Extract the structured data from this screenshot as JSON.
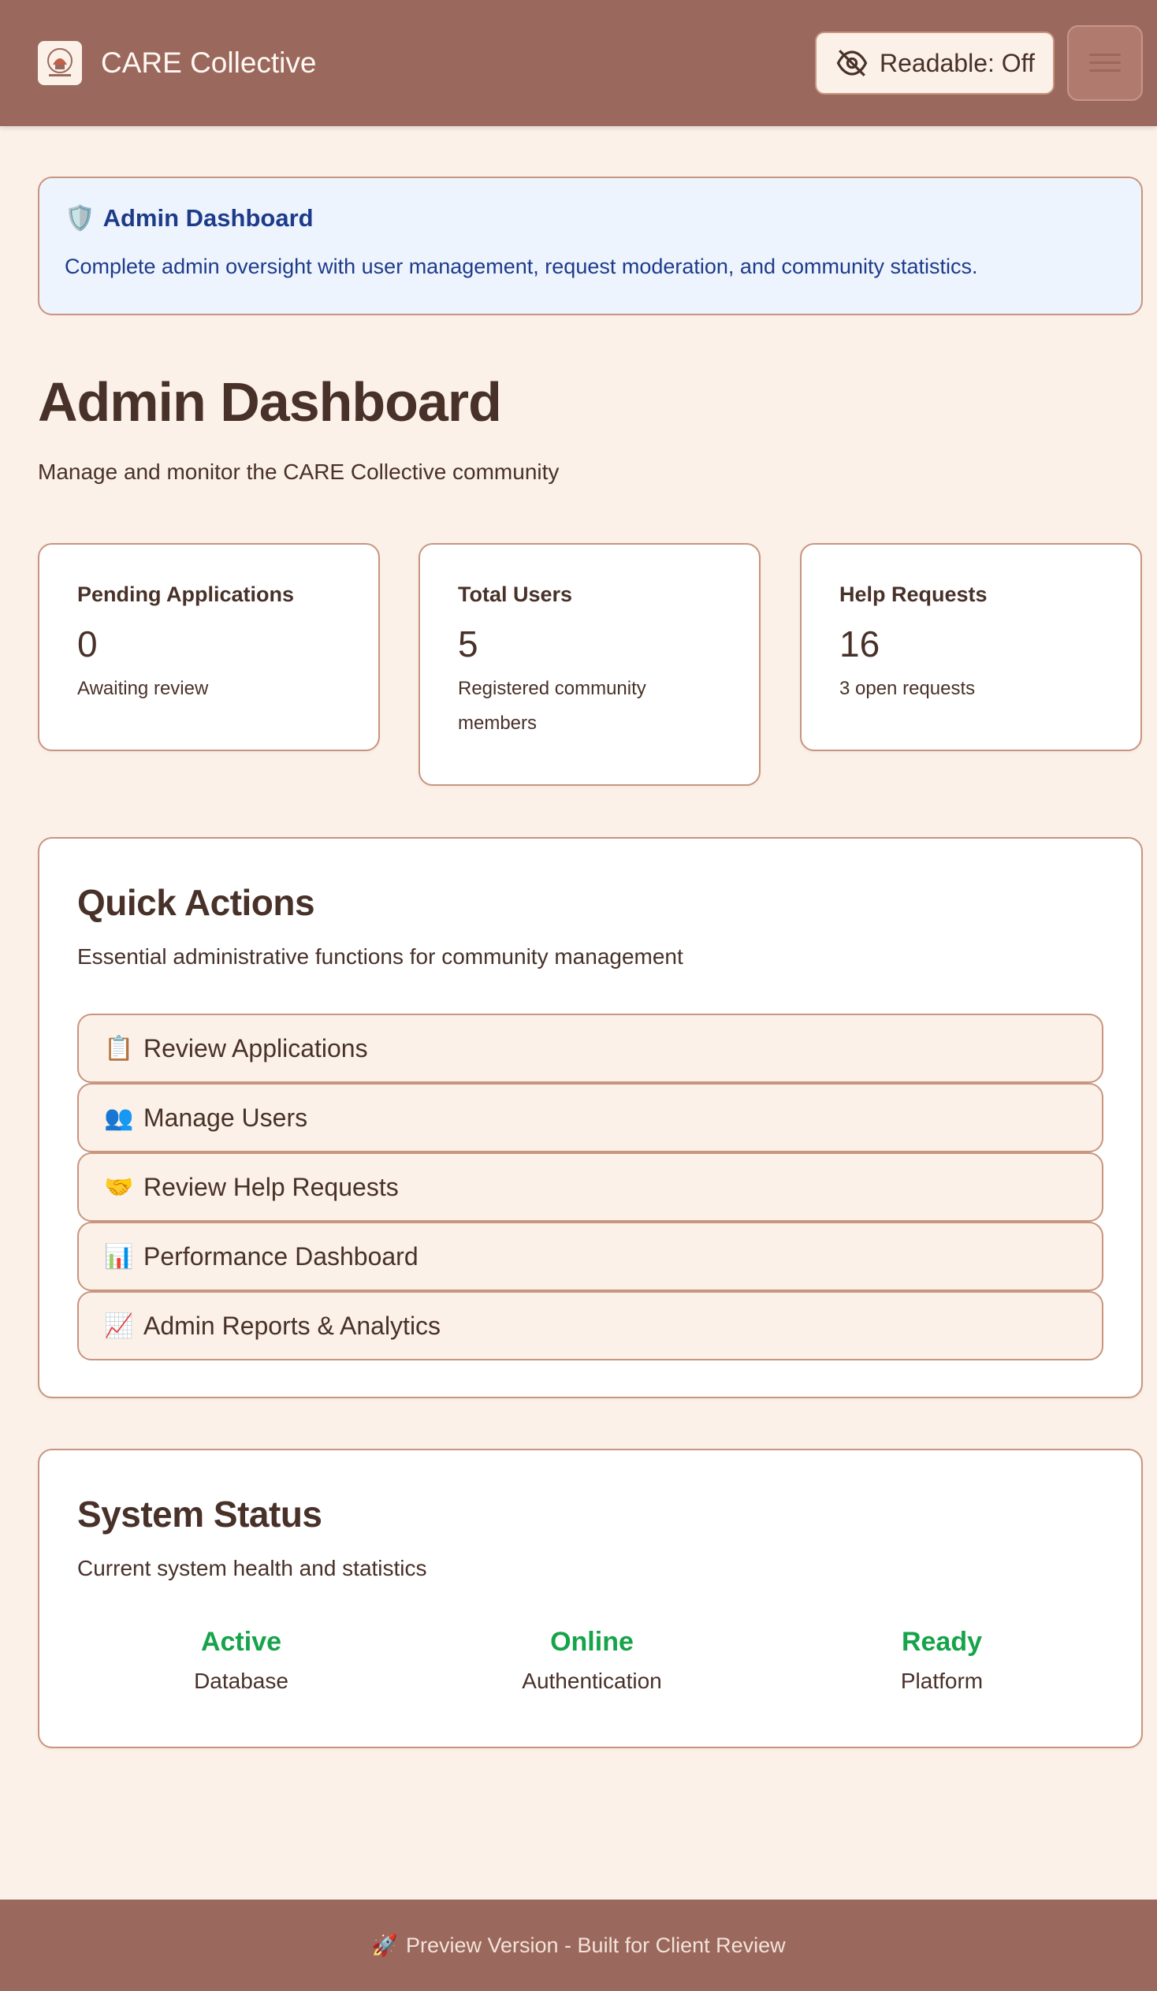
{
  "header": {
    "brand": "CARE Collective",
    "logo_icon": "care-collective-logo",
    "readable_label": "Readable: Off",
    "readable_icon": "eye-off-icon",
    "menu_icon": "hamburger-menu-icon"
  },
  "banner": {
    "icon": "🛡️",
    "title": "Admin Dashboard",
    "text": "Complete admin oversight with user management, request moderation, and community statistics."
  },
  "page": {
    "title": "Admin Dashboard",
    "subtitle": "Manage and monitor the CARE Collective community"
  },
  "stats": [
    {
      "label": "Pending Applications",
      "value": "0",
      "desc": "Awaiting review"
    },
    {
      "label": "Total Users",
      "value": "5",
      "desc": "Registered community members"
    },
    {
      "label": "Help Requests",
      "value": "16",
      "desc": "3 open requests"
    }
  ],
  "quick_actions": {
    "title": "Quick Actions",
    "desc": "Essential administrative functions for community management",
    "items": [
      {
        "emoji": "📋",
        "label": "Review Applications"
      },
      {
        "emoji": "👥",
        "label": "Manage Users"
      },
      {
        "emoji": "🤝",
        "label": "Review Help Requests"
      },
      {
        "emoji": "📊",
        "label": "Performance Dashboard"
      },
      {
        "emoji": "📈",
        "label": "Admin Reports & Analytics"
      }
    ]
  },
  "system_status": {
    "title": "System Status",
    "desc": "Current system health and statistics",
    "items": [
      {
        "value": "Active",
        "label": "Database"
      },
      {
        "value": "Online",
        "label": "Authentication"
      },
      {
        "value": "Ready",
        "label": "Platform"
      }
    ]
  },
  "footer": {
    "emoji": "🚀",
    "text": "Preview Version - Built for Client Review"
  },
  "colors": {
    "header_bg": "#9b685e",
    "page_bg": "#fbf1e8",
    "banner_bg": "#edf4fe",
    "banner_text": "#1e3b8a",
    "status_green": "#16a34a",
    "border": "#c8957f"
  }
}
